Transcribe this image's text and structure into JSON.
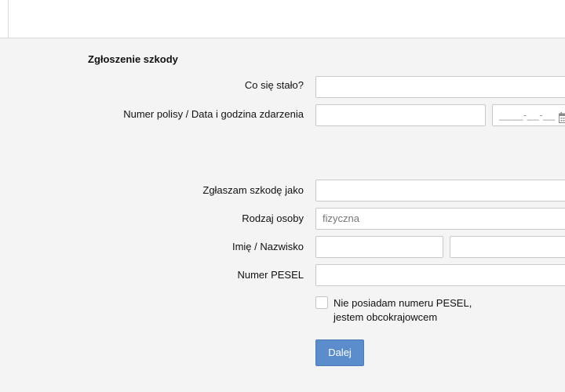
{
  "form": {
    "section_title": "Zgłoszenie szkody",
    "what_happened_label": "Co się stało?",
    "what_happened_value": "",
    "policy_datetime_label": "Numer polisy / Data i godzina zdarzenia",
    "policy_number_value": "",
    "date_placeholder": "____-__-__",
    "report_as_label": "Zgłaszam szkodę jako",
    "report_as_value": "",
    "person_type_label": "Rodzaj osoby",
    "person_type_value": "fizyczna",
    "name_label": "Imię / Nazwisko",
    "first_name_value": "",
    "last_name_value": "",
    "pesel_label": "Numer PESEL",
    "pesel_value": "",
    "no_pesel_line1": "Nie posiadam numeru PESEL,",
    "no_pesel_line2": "jestem obcokrajowcem",
    "next_button": "Dalej"
  },
  "icons": {
    "date_picker": "calendar-icon"
  },
  "colors": {
    "primary_button": "#5b8ccb",
    "background": "#f4f4f4"
  }
}
